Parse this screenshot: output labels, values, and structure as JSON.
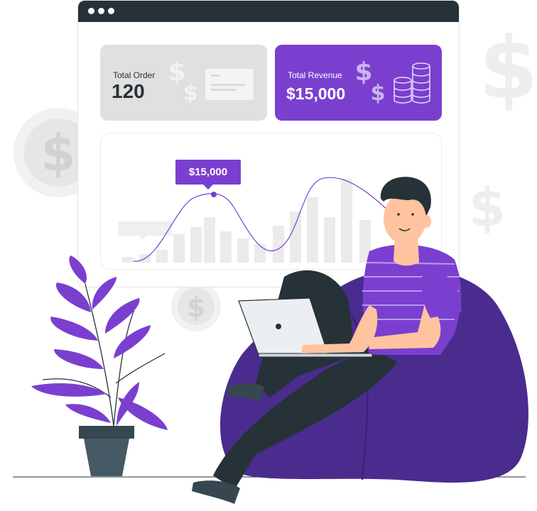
{
  "dashboard": {
    "cards": [
      {
        "label": "Total Order",
        "value": "120"
      },
      {
        "label": "Total Revenue",
        "value": "$15,000"
      }
    ],
    "tooltip": "$15,000"
  },
  "background_money_symbol": "$",
  "colors": {
    "accent_purple": "#7b3fd0",
    "dark_charcoal": "#263238",
    "light_gray": "#e0e0e0",
    "beanbag_purple": "#4a2c8e"
  },
  "icons": [
    "dollar-coin-icon",
    "dollar-sign-icon",
    "credit-card-icon",
    "coin-stack-icon",
    "leaf-icon",
    "laptop-icon",
    "plant-pot-icon"
  ]
}
